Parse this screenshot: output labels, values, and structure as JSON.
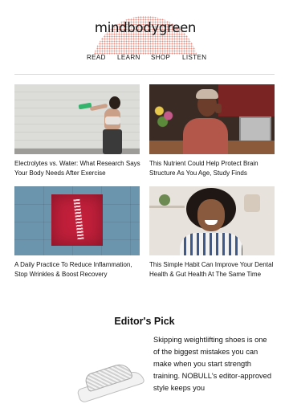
{
  "brand": {
    "logo_text": "mindbodygreen"
  },
  "nav": {
    "items": [
      "READ",
      "LEARN",
      "SHOP",
      "LISTEN"
    ]
  },
  "articles": [
    {
      "title": "Electrolytes vs. Water: What Research Says Your Body Needs After Exercise"
    },
    {
      "title": "This Nutrient Could Help Protect Brain Structure As You Age, Study Finds"
    },
    {
      "title": "A Daily Practice To Reduce Inflammation, Stop Wrinkles & Boost Recovery"
    },
    {
      "title": "This Simple Habit Can Improve Your Dental Health & Gut Health At The Same Time"
    }
  ],
  "editors_pick": {
    "heading": "Editor's Pick",
    "body": "Skipping weightlifting shoes is one of the biggest mistakes you can make when you start strength training. NOBULL's editor-approved style keeps you"
  },
  "colors": {
    "logo_dots": "#e48f86",
    "divider": "#d8d8d8"
  }
}
